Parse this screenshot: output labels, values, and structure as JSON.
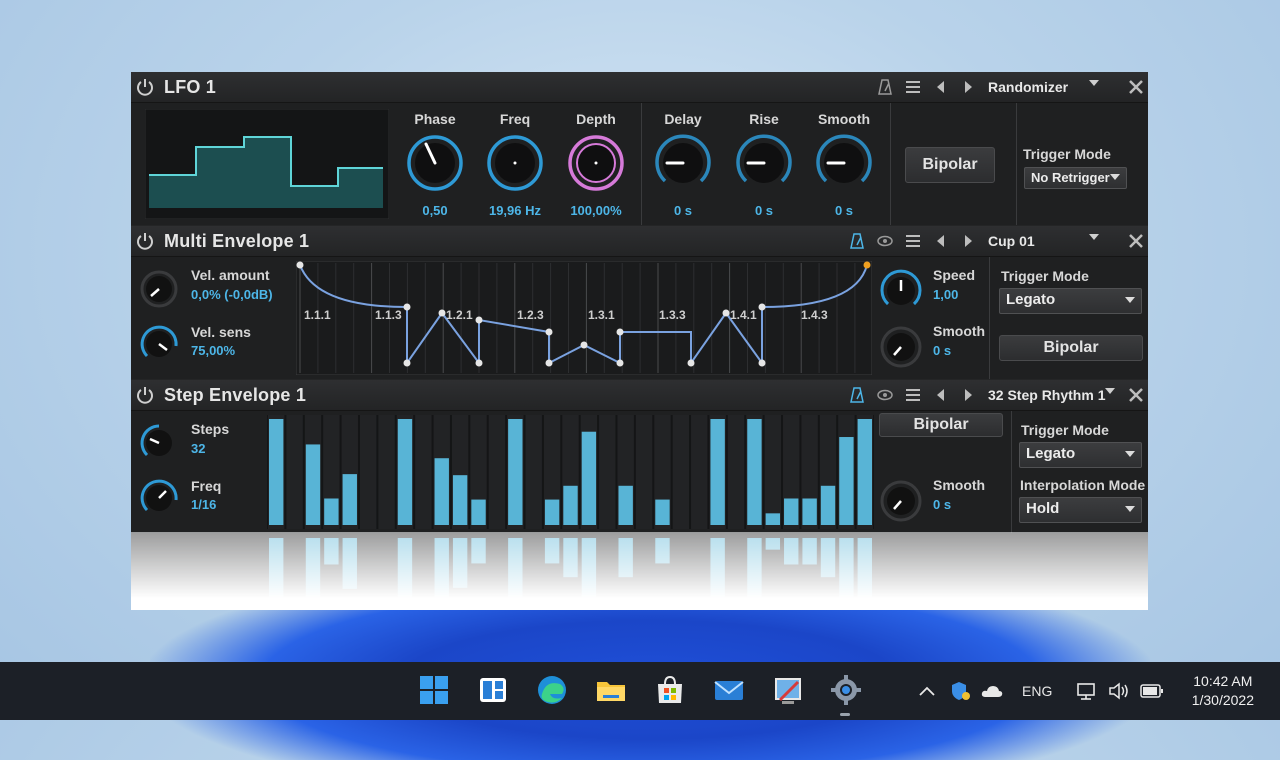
{
  "lfo": {
    "title": "LFO 1",
    "preset": "Randomizer",
    "knobs": [
      {
        "label": "Phase",
        "value": "0,50"
      },
      {
        "label": "Freq",
        "value": "19,96 Hz"
      },
      {
        "label": "Depth",
        "value": "100,00%"
      },
      {
        "label": "Delay",
        "value": "0 s"
      },
      {
        "label": "Rise",
        "value": "0 s"
      },
      {
        "label": "Smooth",
        "value": "0 s"
      }
    ],
    "bipolar_label": "Bipolar",
    "trigger_mode_label": "Trigger Mode",
    "trigger_mode_value": "No Retrigger"
  },
  "multi_env": {
    "title": "Multi Envelope 1",
    "preset": "Cup 01",
    "vel_amount_label": "Vel. amount",
    "vel_amount_value": "0,0% (-0,0dB)",
    "vel_sens_label": "Vel. sens",
    "vel_sens_value": "75,00%",
    "segments": [
      "1.1.1",
      "1.1.3",
      "1.2.1",
      "1.2.3",
      "1.3.1",
      "1.3.3",
      "1.4.1",
      "1.4.3"
    ],
    "speed_label": "Speed",
    "speed_value": "1,00",
    "smooth_label": "Smooth",
    "smooth_value": "0 s",
    "trigger_mode_label": "Trigger Mode",
    "trigger_mode_value": "Legato",
    "bipolar_label": "Bipolar"
  },
  "step_env": {
    "title": "Step Envelope 1",
    "preset": "32 Step Rhythm 1",
    "steps_label": "Steps",
    "steps_value": "32",
    "freq_label": "Freq",
    "freq_value": "1/16",
    "step_levels": [
      1.0,
      0,
      0.76,
      0.25,
      0.48,
      0,
      0,
      1.0,
      0,
      0.63,
      0.47,
      0.24,
      0,
      1.0,
      0,
      0.24,
      0.37,
      0.88,
      0,
      0.37,
      0,
      0.24,
      0,
      0,
      1.0,
      0,
      1.0,
      0.11,
      0.25,
      0.25,
      0.37,
      0.83
    ],
    "step_levels_tail": 1.0,
    "bipolar_label": "Bipolar",
    "smooth_label": "Smooth",
    "smooth_value": "0 s",
    "trigger_mode_label": "Trigger Mode",
    "trigger_mode_value": "Legato",
    "interp_mode_label": "Interpolation Mode",
    "interp_mode_value": "Hold"
  },
  "taskbar": {
    "apps": [
      "start-icon",
      "widgets-icon",
      "edge-icon",
      "file-explorer-icon",
      "store-icon",
      "mail-icon",
      "paint-icon",
      "settings-icon"
    ],
    "language": "ENG",
    "time": "10:42 AM",
    "date": "1/30/2022"
  },
  "colors": {
    "accent": "#4db6e8",
    "depth_ring": "#d67ad9",
    "panel": "#242526"
  }
}
